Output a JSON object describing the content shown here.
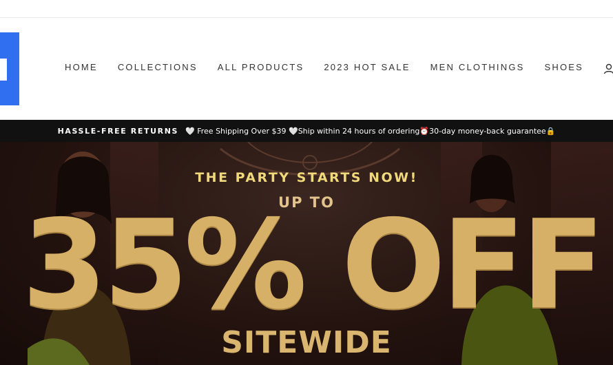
{
  "nav": {
    "items": [
      "HOME",
      "COLLECTIONS",
      "ALL PRODUCTS",
      "2023 HOT SALE",
      "MEN CLOTHINGS",
      "SHOES"
    ]
  },
  "announcement": {
    "lead": "HASSLE-FREE RETURNS",
    "rest": "🤍 Free Shipping Over $39 🤍Ship within 24 hours of ordering⏰30-day money-back guarantee🔒"
  },
  "hero": {
    "tagline": "THE PARTY STARTS NOW!",
    "upto": "UP TO",
    "discount": "35% OFF",
    "sitewide": "SITEWIDE"
  },
  "icons": {
    "account": "user-icon",
    "logo": "logo"
  },
  "colors": {
    "logo": "#2f6ff0",
    "announce_bg": "#111111",
    "hero_gold": "#d6b066"
  }
}
